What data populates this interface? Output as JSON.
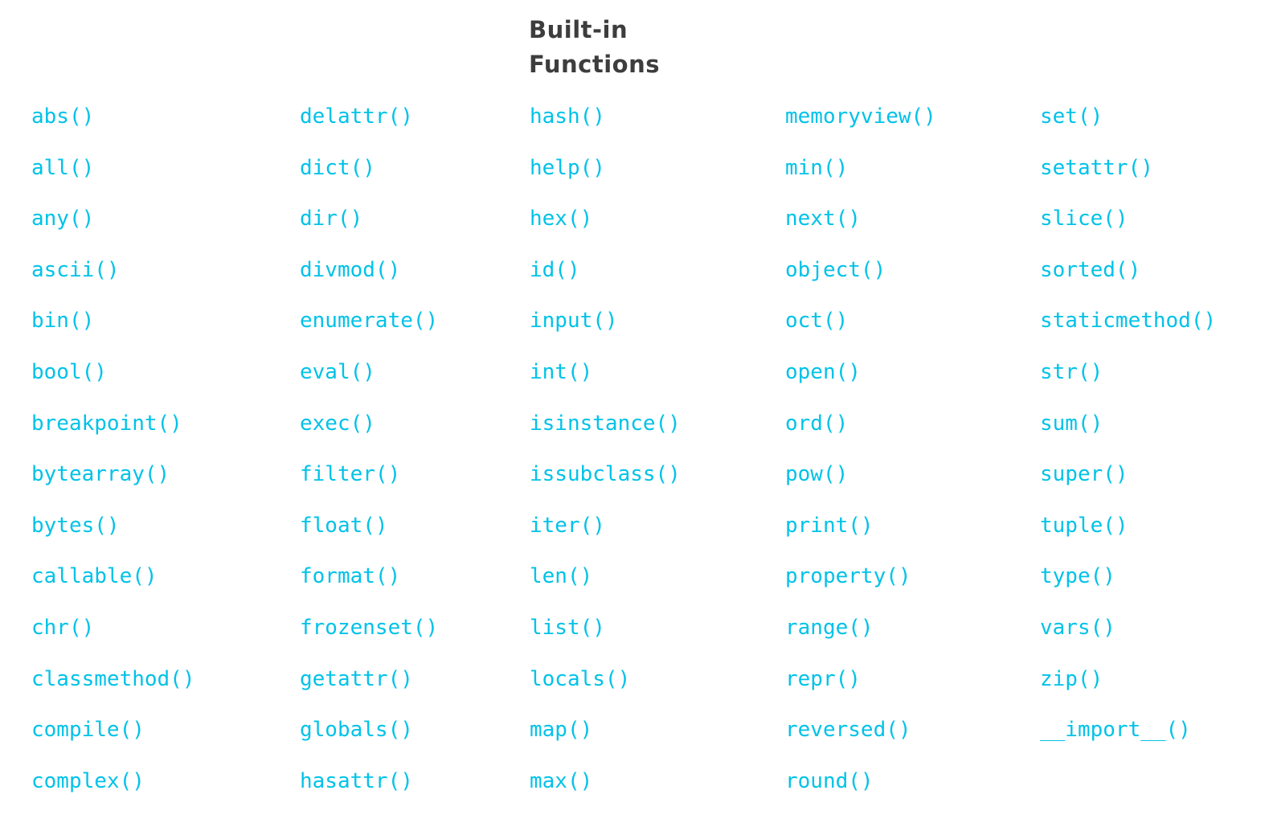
{
  "heading": {
    "line1": "Built-in",
    "line2": "Functions"
  },
  "columns": [
    [
      "abs()",
      "all()",
      "any()",
      "ascii()",
      "bin()",
      "bool()",
      "breakpoint()",
      "bytearray()",
      "bytes()",
      "callable()",
      "chr()",
      "classmethod()",
      "compile()",
      "complex()"
    ],
    [
      "delattr()",
      "dict()",
      "dir()",
      "divmod()",
      "enumerate()",
      "eval()",
      "exec()",
      "filter()",
      "float()",
      "format()",
      "frozenset()",
      "getattr()",
      "globals()",
      "hasattr()"
    ],
    [
      "hash()",
      "help()",
      "hex()",
      "id()",
      "input()",
      "int()",
      "isinstance()",
      "issubclass()",
      "iter()",
      "len()",
      "list()",
      "locals()",
      "map()",
      "max()"
    ],
    [
      "memoryview()",
      "min()",
      "next()",
      "object()",
      "oct()",
      "open()",
      "ord()",
      "pow()",
      "print()",
      "property()",
      "range()",
      "repr()",
      "reversed()",
      "round()"
    ],
    [
      "set()",
      "setattr()",
      "slice()",
      "sorted()",
      "staticmethod()",
      "str()",
      "sum()",
      "super()",
      "tuple()",
      "type()",
      "vars()",
      "zip()",
      "__import__()"
    ]
  ],
  "colors": {
    "link": "#00c2e8",
    "heading": "#3d3d3d",
    "background": "#ffffff"
  }
}
